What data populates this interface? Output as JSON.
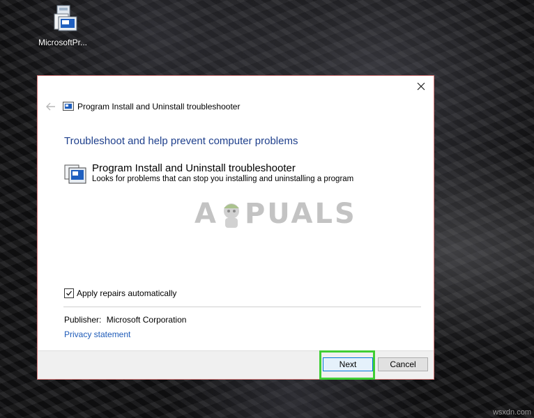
{
  "desktop": {
    "icon_label": "MicrosoftPr..."
  },
  "dialog": {
    "window_title": "Program Install and Uninstall troubleshooter",
    "heading": "Troubleshoot and help prevent computer problems",
    "item": {
      "title": "Program Install and Uninstall troubleshooter",
      "description": "Looks for problems that can stop you installing and uninstalling a program"
    },
    "apply_repairs_label": "Apply repairs automatically",
    "apply_repairs_checked": true,
    "publisher_label": "Publisher:",
    "publisher_value": "Microsoft Corporation",
    "privacy_link": "Privacy statement",
    "next_label": "Next",
    "cancel_label": "Cancel"
  },
  "watermark": {
    "left": "A",
    "right": "PUALS"
  },
  "corner_watermark": "wsxdn.com",
  "colors": {
    "heading": "#1e3f8c",
    "link": "#1e5bb8",
    "highlight": "#3fce34",
    "dialog_border": "#d97a7a"
  }
}
